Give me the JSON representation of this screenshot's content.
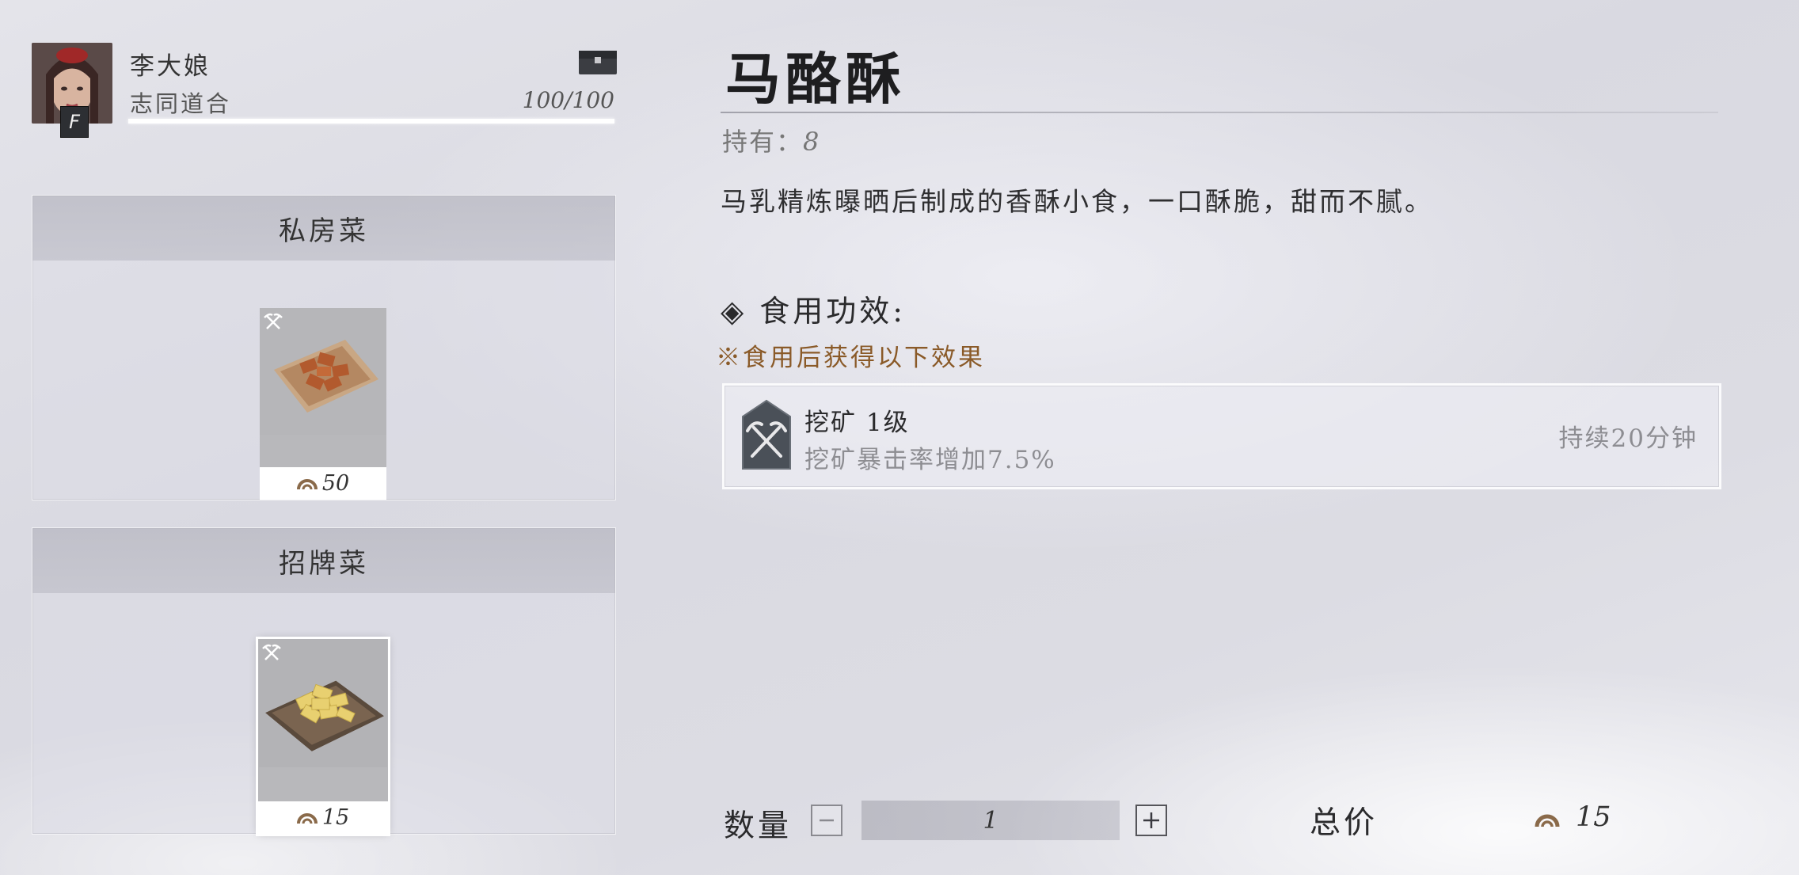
{
  "npc": {
    "name": "李大娘",
    "relation": "志同道合",
    "affinity": "100/100",
    "affinity_fraction": 1.0,
    "rank": "F",
    "chest_icon": "chest-icon"
  },
  "shelves": [
    {
      "title": "私房菜",
      "items": [
        {
          "price": "50",
          "selected": false,
          "tool_icon": "pickaxe-icon"
        }
      ]
    },
    {
      "title": "招牌菜",
      "items": [
        {
          "price": "15",
          "selected": true,
          "tool_icon": "pickaxe-icon"
        }
      ]
    }
  ],
  "detail": {
    "title": "马酪酥",
    "owned_label": "持有：",
    "owned_count": "8",
    "description": "马乳精炼曝晒后制成的香酥小食，一口酥脆，甜而不腻。",
    "effects_heading": "◈ 食用功效:",
    "effects_note": "※食用后获得以下效果",
    "buff": {
      "name": "挖矿 1级",
      "desc": "挖矿暴击率增加7.5%",
      "duration": "持续20分钟",
      "icon": "crossed-pickaxes-icon"
    }
  },
  "purchase": {
    "qty_label": "数量",
    "qty_value": "1",
    "minus_icon": "minus-icon",
    "plus_icon": "plus-icon",
    "total_label": "总价",
    "total_value": "15",
    "currency_icon": "coin-icon"
  },
  "colors": {
    "note_orange": "#8a5a28",
    "coin": "#8a6a4a"
  }
}
